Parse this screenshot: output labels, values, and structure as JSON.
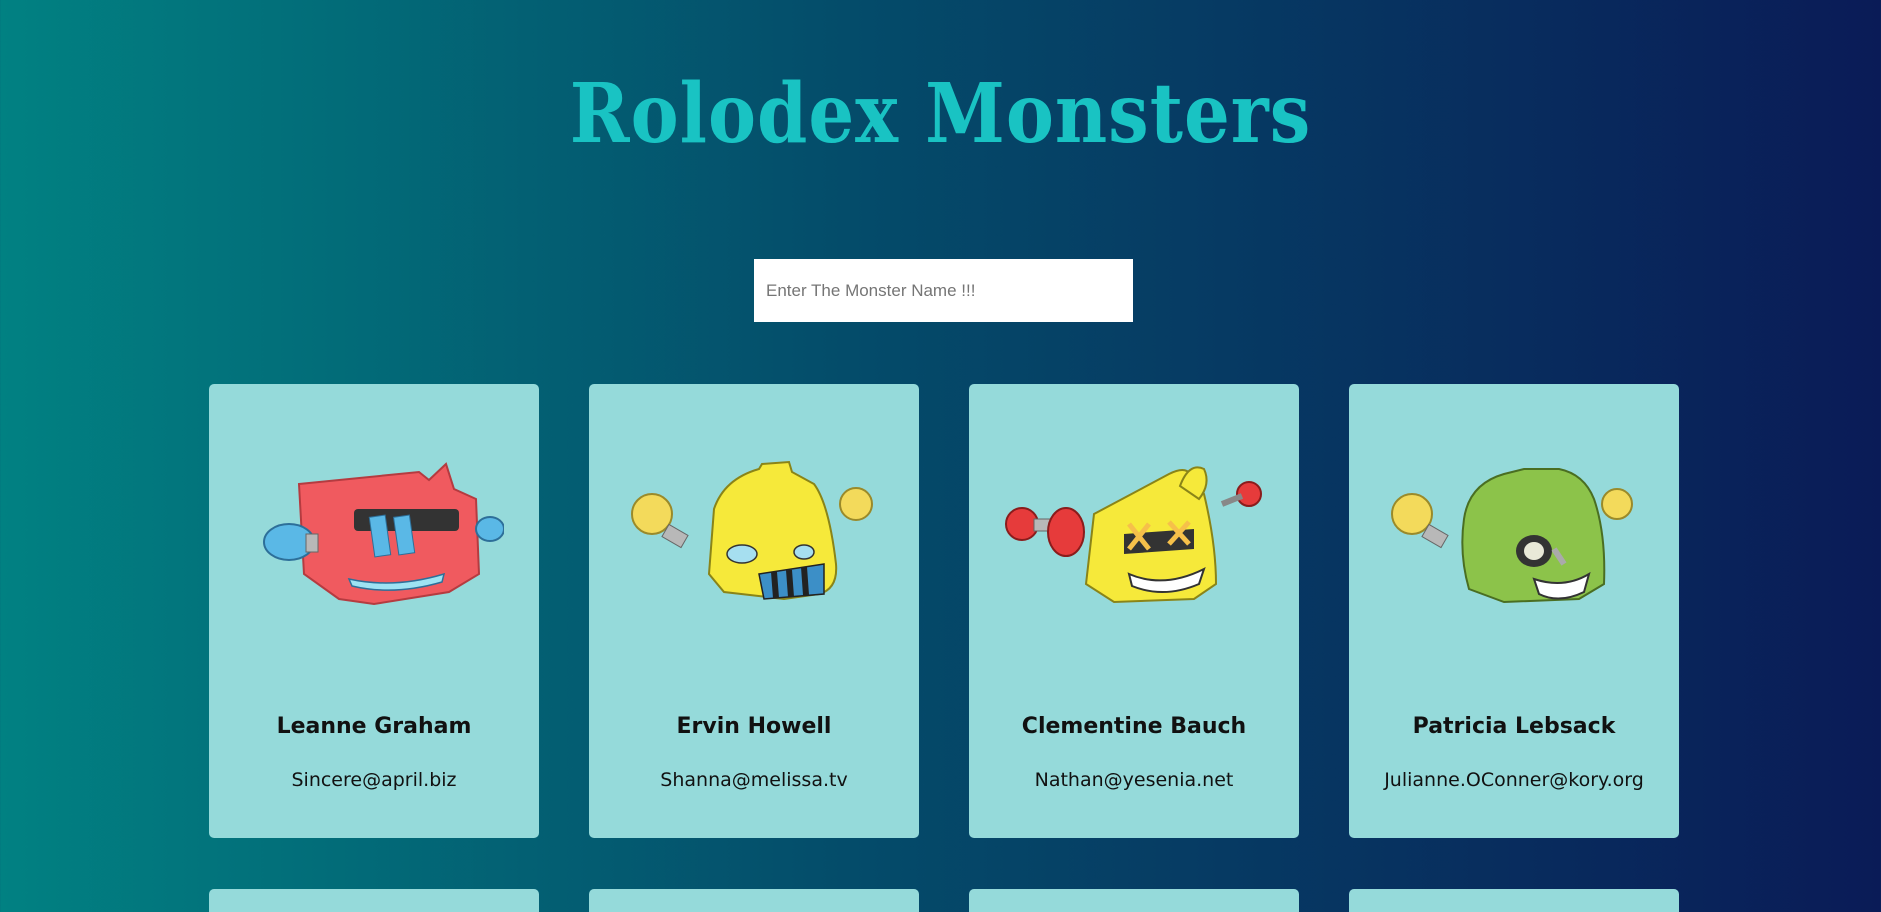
{
  "app": {
    "title": "Rolodex Monsters"
  },
  "search": {
    "placeholder": "Enter The Monster Name !!!",
    "value": ""
  },
  "monsters": [
    {
      "name": "Leanne Graham",
      "email": "Sincere@april.biz",
      "avatar_icon": "red-robot-head-icon",
      "color": "#f05a5f"
    },
    {
      "name": "Ervin Howell",
      "email": "Shanna@melissa.tv",
      "avatar_icon": "yellow-robot-head-icon",
      "color": "#f6e93a"
    },
    {
      "name": "Clementine Bauch",
      "email": "Nathan@yesenia.net",
      "avatar_icon": "yellow-robot-head-icon",
      "color": "#f6e93a"
    },
    {
      "name": "Patricia Lebsack",
      "email": "Julianne.OConner@kory.org",
      "avatar_icon": "green-robot-head-icon",
      "color": "#8cc34a"
    }
  ],
  "colors": {
    "gradient_start": "#018182",
    "gradient_end": "#0a1b57",
    "title": "#19c3c3",
    "card_background": "#95dada"
  }
}
